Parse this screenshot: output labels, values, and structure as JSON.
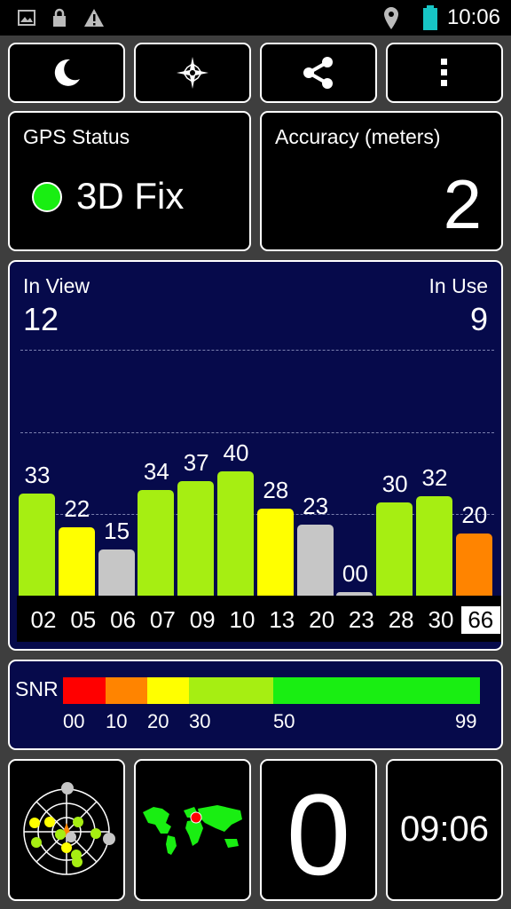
{
  "status_bar": {
    "time": "10:06",
    "icons": [
      "image-icon",
      "lock-icon",
      "warning-icon",
      "location-pin-icon",
      "battery-icon"
    ],
    "battery_color": "#17c5c5"
  },
  "toolbar": {
    "buttons": [
      "moon-icon",
      "compass-icon",
      "share-icon",
      "overflow-menu-icon"
    ]
  },
  "gps_status": {
    "label": "GPS Status",
    "value": "3D Fix",
    "indicator_color": "#19ee12"
  },
  "accuracy": {
    "label": "Accuracy (meters)",
    "value": "2"
  },
  "satellites": {
    "in_view_label": "In View",
    "in_view_value": "12",
    "in_use_label": "In Use",
    "in_use_value": "9",
    "selected_prn": "66"
  },
  "chart_data": {
    "type": "bar",
    "categories": [
      "02",
      "05",
      "06",
      "07",
      "09",
      "10",
      "13",
      "20",
      "23",
      "28",
      "30",
      "66"
    ],
    "values": [
      33,
      22,
      15,
      34,
      37,
      40,
      28,
      23,
      0,
      30,
      32,
      20
    ],
    "value_labels": [
      "33",
      "22",
      "15",
      "34",
      "37",
      "40",
      "28",
      "23",
      "00",
      "30",
      "32",
      "20"
    ],
    "bar_colors": [
      "#a6ee12",
      "#ffff00",
      "#c6c6c6",
      "#a6ee12",
      "#a6ee12",
      "#a6ee12",
      "#ffff00",
      "#c6c6c6",
      "#c6c6c6",
      "#a6ee12",
      "#a6ee12",
      "#ff8400"
    ],
    "ylim": [
      0,
      50
    ]
  },
  "snr_legend": {
    "label": "SNR",
    "ticks": [
      "00",
      "10",
      "20",
      "30",
      "50",
      "99"
    ],
    "colors": [
      "#ff0000",
      "#ff8400",
      "#ffff00",
      "#a6ee12",
      "#19ee12"
    ]
  },
  "bottom": {
    "satellites_count": "0",
    "time": "09:06",
    "map_marker_color": "#ff0000"
  }
}
